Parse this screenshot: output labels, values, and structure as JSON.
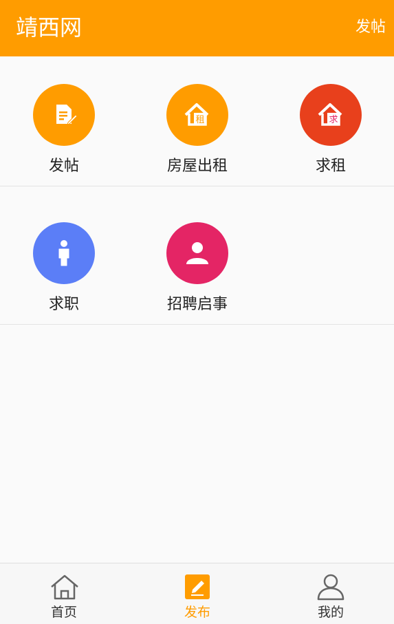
{
  "header": {
    "title": "靖西网",
    "post_link": "发帖"
  },
  "categories": [
    {
      "label": "发帖",
      "icon": "document-edit-icon",
      "color": "#ff9c00"
    },
    {
      "label": "房屋出租",
      "icon": "house-rent-icon",
      "badge": "租",
      "color": "#ff9c00"
    },
    {
      "label": "求租",
      "icon": "house-seek-icon",
      "badge": "求",
      "color": "#e8401c"
    },
    {
      "label": "求职",
      "icon": "person-icon",
      "color": "#5b7ef7"
    },
    {
      "label": "招聘启事",
      "icon": "user-icon",
      "color": "#e42565"
    }
  ],
  "tabbar": {
    "items": [
      {
        "label": "首页",
        "icon": "home-icon",
        "active": false
      },
      {
        "label": "发布",
        "icon": "edit-icon",
        "active": true
      },
      {
        "label": "我的",
        "icon": "profile-icon",
        "active": false
      }
    ],
    "active_color": "#ff9c00"
  }
}
